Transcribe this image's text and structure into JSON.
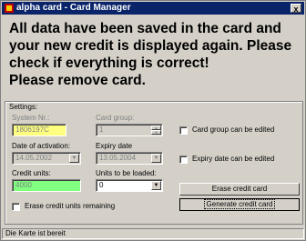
{
  "window": {
    "title": "alpha card - Card Manager",
    "close_label": "x"
  },
  "message": {
    "line1": "All data have been saved in the card and",
    "line2": "your new credit is displayed again. Please",
    "line3": "check if everything is correct!",
    "line4": "Please remove card."
  },
  "settings": {
    "legend": "Settings:",
    "system_nr": {
      "label": "System Nr.:",
      "value": "1806197C"
    },
    "card_group": {
      "label": "Card group:",
      "value": "1"
    },
    "date_of_activation": {
      "label": "Date of activation:",
      "value": "14.05.2002"
    },
    "expiry_date": {
      "label": "Expiry date",
      "value": "13.05.2004"
    },
    "credit_units": {
      "label": "Credit units:",
      "value": "4000"
    },
    "units_to_be_loaded": {
      "label": "Units to be loaded:",
      "value": "0"
    },
    "chk_card_group": "Card group can be edited",
    "chk_expiry_date": "Expiry date can be edited",
    "chk_erase_remaining": "Erase credit units remaining",
    "erase_button": "Erase credit card",
    "generate_button": "Generate credit card"
  },
  "status": {
    "text": "Die Karte ist bereit"
  },
  "colors": {
    "title_bg": "#0a246a",
    "yellow_field": "#ffff80",
    "green_field": "#80ff80"
  }
}
